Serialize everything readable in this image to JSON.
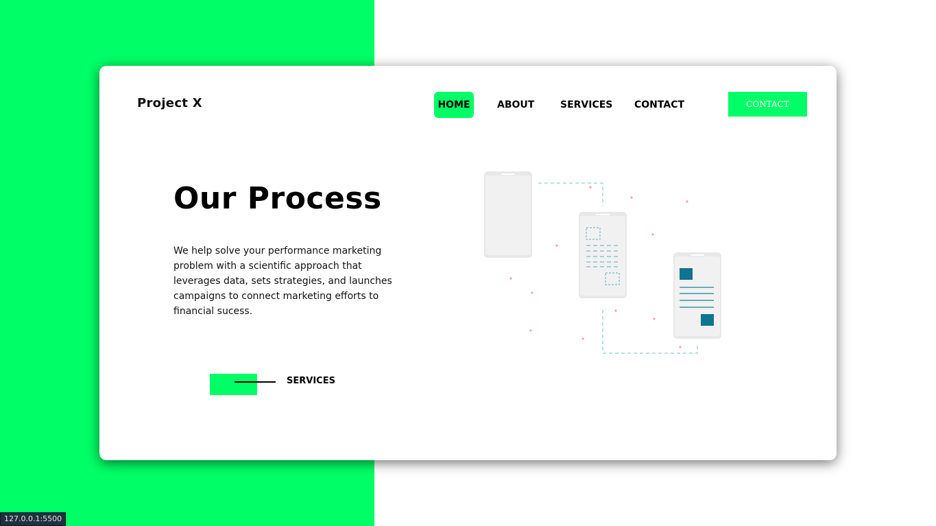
{
  "brand": {
    "name": "Project X"
  },
  "nav": {
    "home": "HOME",
    "about": "ABOUT",
    "services": "SERVICES",
    "contact": "CONTACT"
  },
  "header_button": {
    "label": "CONTACT"
  },
  "hero": {
    "title": "Our Process",
    "description": "We help solve your performance marketing problem with a scientific approach that leverages data, sets strategies, and launches campaigns to connect marketing efforts to financial sucess.",
    "cta_label": "SERVICES"
  },
  "status_bar": {
    "url": "127.0.0.1:5500"
  },
  "colors": {
    "accent": "#00ff66",
    "illustration_teal": "#0e7490",
    "illustration_dots": "#f4a3a3"
  },
  "icons": {
    "illustration": "phones-process-illustration"
  }
}
